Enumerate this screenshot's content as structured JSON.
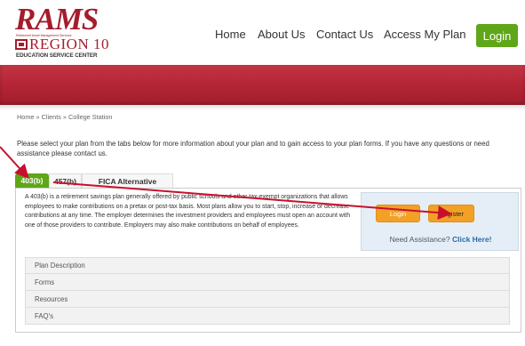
{
  "header": {
    "logo_main": "RAMS",
    "logo_sub": "Retirement Asset Management Services",
    "logo_region": "REGION 10",
    "logo_esc": "EDUCATION SERVICE CENTER",
    "nav": [
      "Home",
      "About Us",
      "Contact Us",
      "Access My Plan"
    ],
    "login_label": "Login"
  },
  "breadcrumb": "Home » Clients » College Station",
  "intro": "Please select your plan from the tabs below for more information about your plan and to gain access to your plan forms. If you have any questions or need assistance please contact us.",
  "tabs": [
    "403(b)",
    "457(b)",
    "FICA Alternative"
  ],
  "description": "A 403(b) is a retirement savings plan generally offered by public schools and other tax-exempt organizations that allows employees to make contributions on a pretax or post-tax basis. Most plans allow you to start, stop, increase or decrease contributions at any time. The employer determines the investment providers and employees must open an account with one of those providers to contribute. Employers may also make contributions on behalf of employees.",
  "assist": {
    "login_label": "Login",
    "register_label": "Register",
    "help_prefix": "Need Assistance? ",
    "help_link": "Click Here!"
  },
  "accordion": [
    "Plan Description",
    "Forms",
    "Resources",
    "FAQ's"
  ],
  "colors": {
    "brand_red": "#a51c2b",
    "green": "#5fa619",
    "orange": "#f3a126",
    "annotation_red": "#c8102e"
  }
}
